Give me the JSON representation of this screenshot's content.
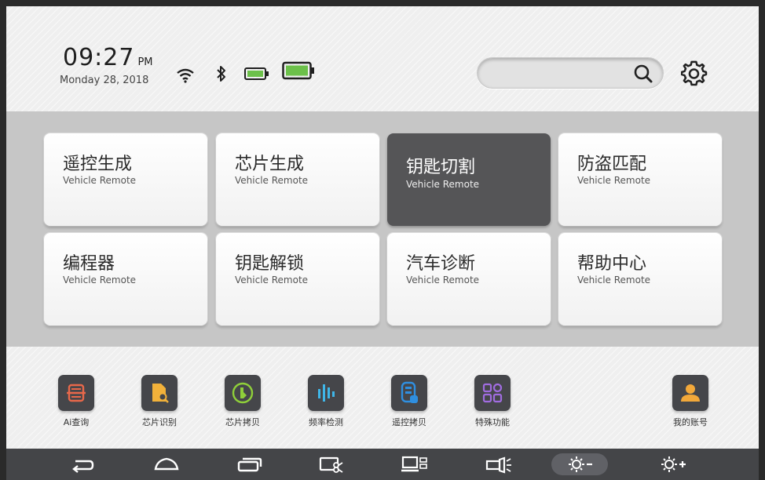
{
  "status": {
    "time": "09:27",
    "ampm": "PM",
    "date": "Monday 28, 2018"
  },
  "search": {
    "placeholder": ""
  },
  "tiles": [
    {
      "title": "遥控生成",
      "subtitle": "Vehicle Remote"
    },
    {
      "title": "芯片生成",
      "subtitle": "Vehicle Remote"
    },
    {
      "title": "钥匙切割",
      "subtitle": "Vehicle Remote"
    },
    {
      "title": "防盗匹配",
      "subtitle": "Vehicle Remote"
    },
    {
      "title": "编程器",
      "subtitle": "Vehicle Remote"
    },
    {
      "title": "钥匙解锁",
      "subtitle": "Vehicle Remote"
    },
    {
      "title": "汽车诊断",
      "subtitle": "Vehicle Remote"
    },
    {
      "title": "帮助中心",
      "subtitle": "Vehicle Remote"
    }
  ],
  "quick_actions": [
    {
      "label": "Ai查询",
      "icon": "ai-query-icon",
      "color": "#e8684a"
    },
    {
      "label": "芯片识别",
      "icon": "chip-identify-icon",
      "color": "#f2b13a"
    },
    {
      "label": "芯片拷贝",
      "icon": "chip-copy-icon",
      "color": "#8fcf3a"
    },
    {
      "label": "频率检测",
      "icon": "frequency-icon",
      "color": "#3fb6e8"
    },
    {
      "label": "遥控拷贝",
      "icon": "remote-copy-icon",
      "color": "#2f8fe0"
    },
    {
      "label": "特殊功能",
      "icon": "special-function-icon",
      "color": "#a06ce0"
    },
    {
      "label": "我的账号",
      "icon": "account-icon",
      "color": "#f2a83a"
    }
  ],
  "navbar": [
    {
      "icon": "back-icon"
    },
    {
      "icon": "home-icon"
    },
    {
      "icon": "recent-apps-icon"
    },
    {
      "icon": "screenshot-icon"
    },
    {
      "icon": "screen-cast-icon"
    },
    {
      "icon": "flashlight-icon"
    },
    {
      "icon": "brightness-down-icon"
    },
    {
      "icon": "brightness-up-icon"
    }
  ],
  "colors": {
    "accent_battery": "#6cc04a",
    "active_tile": "#555557",
    "navbar": "#444548"
  }
}
